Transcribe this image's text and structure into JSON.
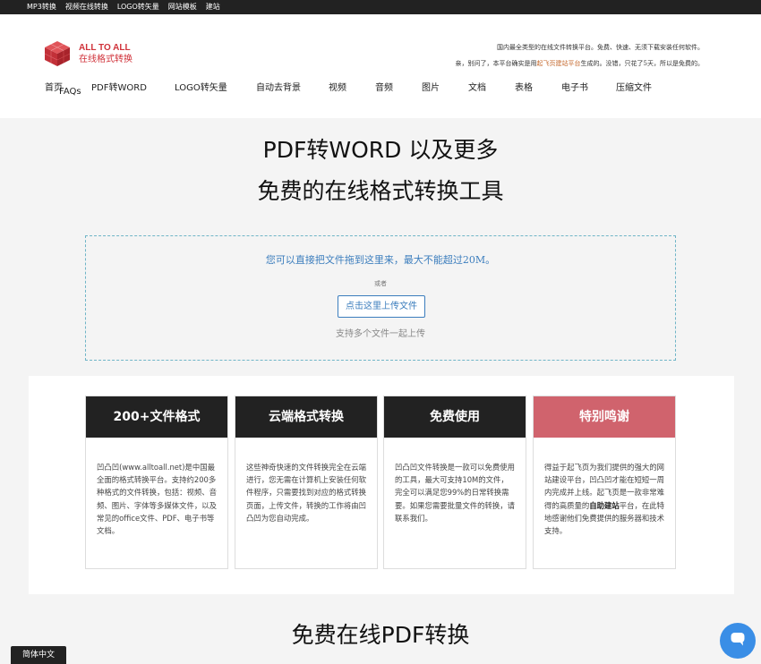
{
  "topbar": {
    "links": [
      "MP3转换",
      "视频在线转换",
      "LOGO转矢量",
      "网站模板",
      "建站"
    ]
  },
  "logo": {
    "title": "ALL TO ALL",
    "subtitle": "在线格式转换"
  },
  "header_note": {
    "line1": "国内最全类型的在线文件转换平台。免费、快速、无须下载安装任何软件。",
    "line2_prefix": "亲，别问了，本平台确实是用",
    "line2_highlight": "起飞页建站平台",
    "line2_suffix": "生成的。没错，只花了5天，所以是免费的。"
  },
  "nav": {
    "items": [
      "首页",
      "PDF转WORD",
      "LOGO转矢量",
      "自动去背景",
      "视频",
      "音频",
      "图片",
      "文档",
      "表格",
      "电子书",
      "压缩文件"
    ],
    "faq": "FAQs"
  },
  "hero": {
    "title1": "PDF转WORD 以及更多",
    "title2": "免费的在线格式转换工具"
  },
  "dropzone": {
    "main_text": "您可以直接把文件拖到这里来，最大不能超过20M。",
    "or_text": "或者",
    "button_label": "点击这里上传文件",
    "multi_text": "支持多个文件一起上传"
  },
  "features": [
    {
      "title": "200+文件格式",
      "body": "凹凸凹(www.alltoall.net)是中国最全面的格式转换平台。支持约200多种格式的文件转换，包括：视频、音频、图片、字体等多媒体文件，以及常见的office文件、PDF、电子书等文档。"
    },
    {
      "title": "云端格式转换",
      "body": "这些神奇快速的文件转换完全在云端进行，您无需在计算机上安装任何软件程序，只需要找到对应的格式转换页面，上传文件，转换的工作将由凹凸凹为您自动完成。"
    },
    {
      "title": "免费使用",
      "body": "凹凸凹文件转换是一款可以免费使用的工具，最大可支持10M的文件，完全可以满足您99%的日常转换需要。如果您需要批量文件的转换，请联系我们。"
    },
    {
      "title": "特别鸣谢",
      "body_prefix": "得益于起飞页为我们提供的强大的网站建设平台，凹凸凹才能在短短一周内完成并上线。起飞页是一款非常难得的高质量的",
      "body_bold": "自助建站",
      "body_suffix": "平台，在此特地感谢他们免费提供的服务器和技术支持。"
    }
  ],
  "bottom": {
    "title": "免费在线PDF转换"
  },
  "lang_button": "简体中文",
  "colors": {
    "accent_red": "#d0323a",
    "accent_blue": "#3b7dbd",
    "card_dark": "#222222",
    "card_red": "#d0636d",
    "chat_blue": "#3a8ee6"
  }
}
